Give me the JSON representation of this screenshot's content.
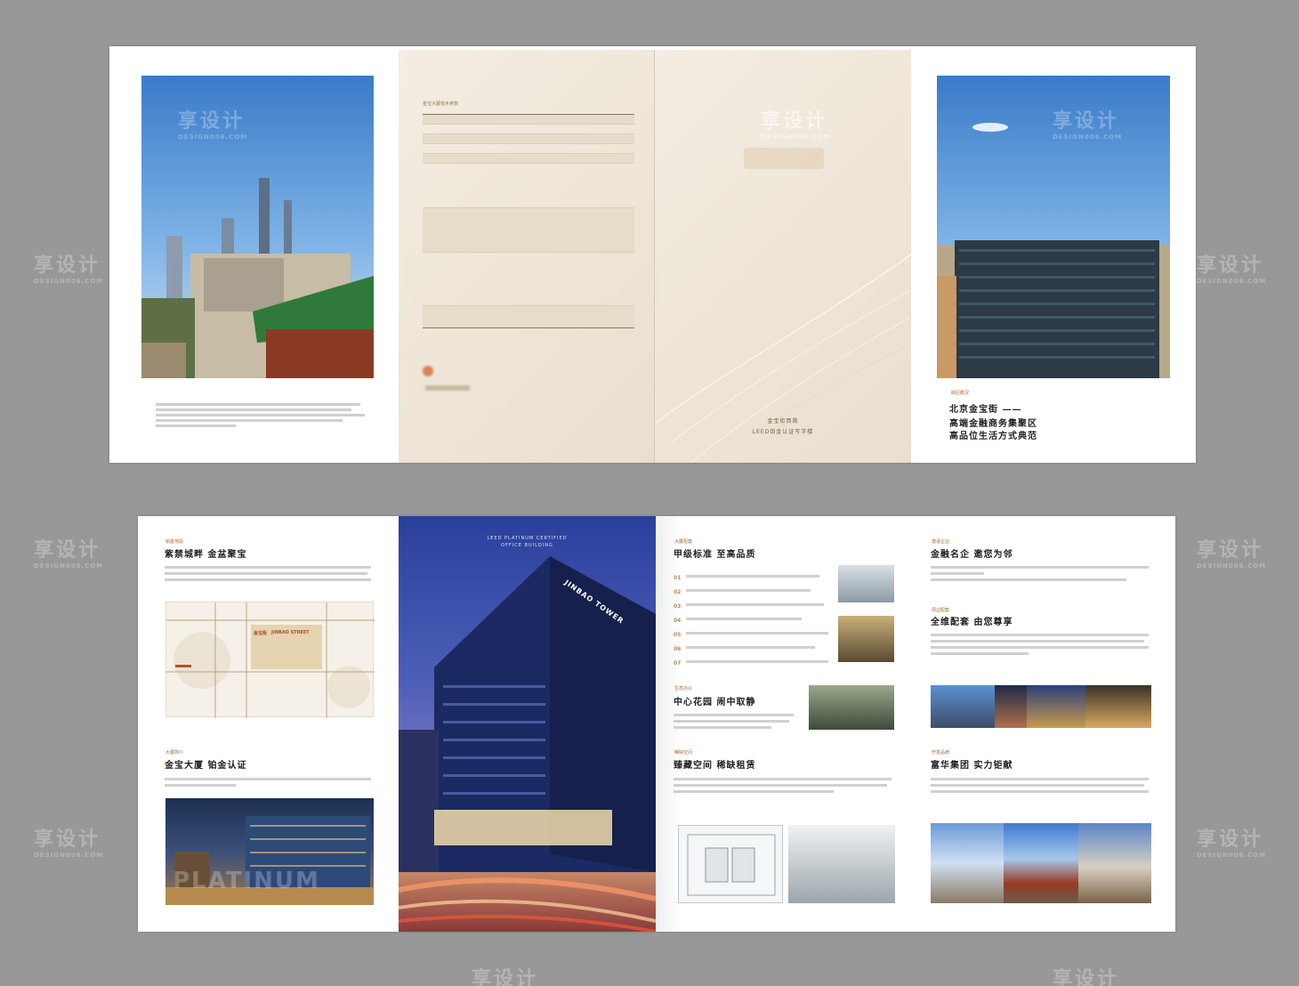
{
  "watermark": {
    "cn": "享设计",
    "en": "DESIGN006.COM"
  },
  "top_spread": {
    "specs_title": "金宝大厦技术参数",
    "spine_text": [
      "金宝街西首",
      "LEED铂金认证写字楼"
    ],
    "overview": {
      "tag": "街区概况",
      "title": "北京金宝街 ——",
      "line2": "高端金融商务集聚区",
      "line3": "高品位生活方式典范"
    }
  },
  "bottom_spread": {
    "p1": {
      "tag1": "铂金地段",
      "title1": "紫禁城畔 金盆聚宝",
      "map_labels": {
        "jinbao_street": "JINBAO STREET",
        "jinbao": "金宝街"
      },
      "tag2": "大厦简介",
      "title2": "金宝大厦 铂金认证",
      "photo_overlay": "PLATINUM"
    },
    "p2": {
      "header": "LEED PLATINUM CERTIFIED",
      "subheader": "OFFICE BUILDING",
      "sign": "JINBAO TOWER"
    },
    "p3": {
      "tag1": "大厦配套",
      "title1": "甲级标准 至高品质",
      "numbers": [
        "01",
        "02",
        "03",
        "04",
        "05",
        "06",
        "07"
      ],
      "tag2": "生态办公",
      "title2": "中心花园 闹中取静",
      "tag3": "稀缺空间",
      "title3": "臻藏空间 稀缺租赁"
    },
    "p4": {
      "tag1": "邀请企业",
      "title1": "金融名企 邀您为邻",
      "tag2": "周边配套",
      "title2": "全维配套 由您尊享",
      "tag3": "开发品牌",
      "title3": "富华集团 实力钜献"
    }
  }
}
